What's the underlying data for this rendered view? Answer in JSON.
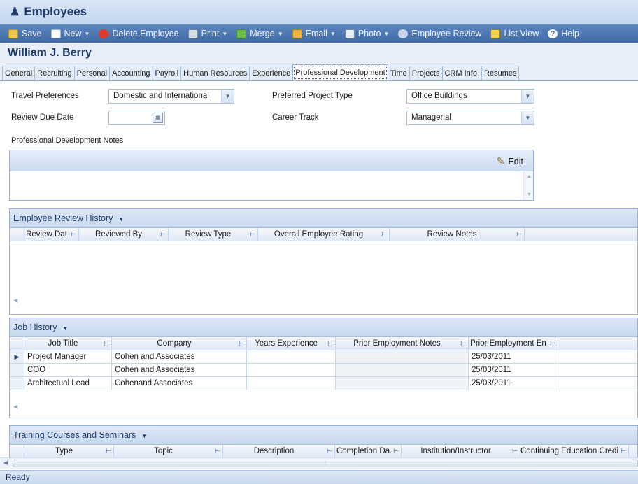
{
  "window": {
    "title": "Employees"
  },
  "toolbar": {
    "save": "Save",
    "new": "New",
    "delete": "Delete Employee",
    "print": "Print",
    "merge": "Merge",
    "email": "Email",
    "photo": "Photo",
    "review": "Employee Review",
    "list_view": "List View",
    "help": "Help"
  },
  "employee": {
    "name": "William J. Berry"
  },
  "tabs": [
    "General",
    "Recruiting",
    "Personal",
    "Accounting",
    "Payroll",
    "Human Resources",
    "Experience",
    "Professional Development",
    "Time",
    "Projects",
    "CRM Info.",
    "Resumes"
  ],
  "form": {
    "travel_label": "Travel Preferences",
    "travel_value": "Domestic and International",
    "review_due_label": "Review Due Date",
    "review_due_value": "",
    "project_type_label": "Preferred Project Type",
    "project_type_value": "Office Buildings",
    "career_track_label": "Career Track",
    "career_track_value": "Managerial",
    "notes_label": "Professional Development Notes",
    "edit_label": "Edit"
  },
  "review_history": {
    "title": "Employee Review History",
    "columns": [
      "Review Dat",
      "Reviewed By",
      "Review Type",
      "Overall Employee Rating",
      "Review Notes"
    ]
  },
  "job_history": {
    "title": "Job History",
    "columns": [
      "Job Title",
      "Company",
      "Years Experience",
      "Prior Employment Notes",
      "Prior Employment En"
    ],
    "rows": [
      {
        "title": "Project Manager",
        "company": "Cohen and Associates",
        "years": "",
        "notes": "",
        "end": "25/03/2011"
      },
      {
        "title": "COO",
        "company": "Cohen and Associates",
        "years": "",
        "notes": "",
        "end": "25/03/2011"
      },
      {
        "title": "Architectual Lead",
        "company": "Cohenand Associates",
        "years": "",
        "notes": "",
        "end": "25/03/2011"
      }
    ]
  },
  "training": {
    "title": "Training Courses and Seminars",
    "columns": [
      "Type",
      "Topic",
      "Description",
      "Completion Da",
      "Institution/Instructor",
      "Continuing Education Credi"
    ]
  },
  "status": {
    "text": "Ready"
  }
}
